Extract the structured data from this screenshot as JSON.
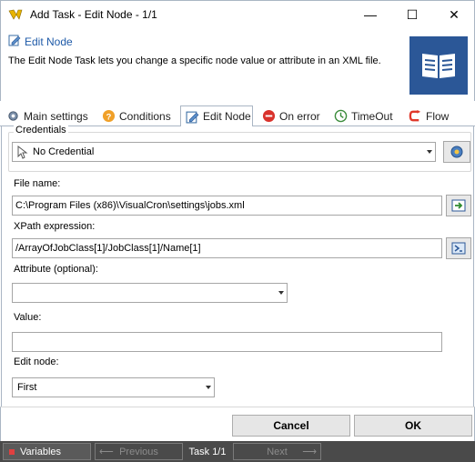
{
  "window": {
    "title": "Add Task - Edit Node - 1/1",
    "minimize": "—",
    "maximize": "☐",
    "close": "✕"
  },
  "header": {
    "title": "Edit Node",
    "description": "The Edit Node Task lets you change a specific node value or attribute in an XML file."
  },
  "tabs": [
    {
      "label": "Main settings",
      "icon": "gear-icon"
    },
    {
      "label": "Conditions",
      "icon": "question-icon"
    },
    {
      "label": "Edit Node",
      "icon": "edit-node-icon",
      "active": true
    },
    {
      "label": "On error",
      "icon": "error-icon"
    },
    {
      "label": "TimeOut",
      "icon": "timeout-icon"
    },
    {
      "label": "Flow",
      "icon": "flow-icon"
    }
  ],
  "credentials": {
    "group_label": "Credentials",
    "selected": "No Credential"
  },
  "fields": {
    "file_name_label": "File name:",
    "file_name_value": "C:\\Program Files (x86)\\VisualCron\\settings\\jobs.xml",
    "xpath_label": "XPath expression:",
    "xpath_value": "/ArrayOfJobClass[1]/JobClass[1]/Name[1]",
    "attribute_label": "Attribute (optional):",
    "attribute_value": "",
    "value_label": "Value:",
    "value_value": "",
    "edit_node_label": "Edit node:",
    "edit_node_value": "First"
  },
  "buttons": {
    "cancel": "Cancel",
    "ok": "OK"
  },
  "statusbar": {
    "variables": "Variables",
    "previous": "Previous",
    "task": "Task 1/1",
    "next": "Next"
  },
  "colors": {
    "accent": "#2b5797",
    "header_title": "#1e5aa8",
    "statusbar": "#4a4a4a"
  }
}
